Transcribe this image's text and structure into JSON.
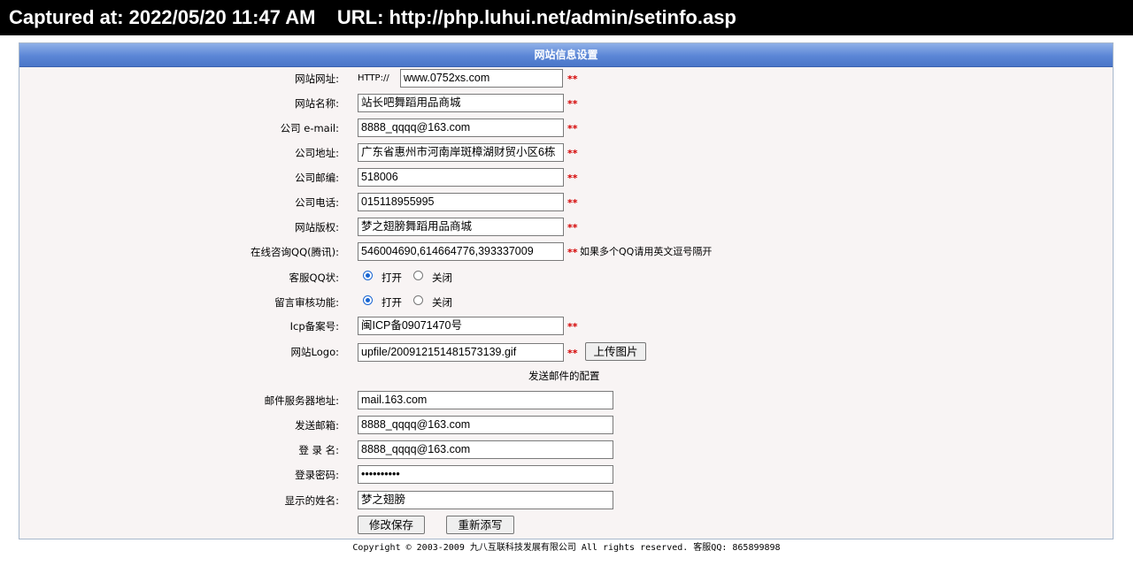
{
  "capture": {
    "text": "Captured at: 2022/05/20 11:47 AM    URL: http://php.luhui.net/admin/setinfo.asp"
  },
  "panel": {
    "title": "网站信息设置"
  },
  "required_mark": "**",
  "fields": {
    "site_url": {
      "label": "网站网址:",
      "prefix": "HTTP://",
      "value": "www.0752xs.com"
    },
    "site_name": {
      "label": "网站名称:",
      "value": "站长吧舞蹈用品商城"
    },
    "company_email": {
      "label": "公司 e-mail:",
      "value": "8888_qqqq@163.com"
    },
    "company_address": {
      "label": "公司地址:",
      "value": "广东省惠州市河南岸斑樟湖财贸小区6栋"
    },
    "company_zip": {
      "label": "公司邮编:",
      "value": "518006"
    },
    "company_phone": {
      "label": "公司电话:",
      "value": "015118955995"
    },
    "site_copyright": {
      "label": "网站版权:",
      "value": "梦之翅膀舞蹈用品商城"
    },
    "online_qq": {
      "label": "在线咨询QQ(腾讯):",
      "value": "546004690,614664776,393337009",
      "hint": "如果多个QQ请用英文逗号隔开"
    },
    "service_qq_status": {
      "label": "客服QQ状:",
      "options": [
        "打开",
        "关闭"
      ],
      "selected": "打开"
    },
    "message_review": {
      "label": "留言审核功能:",
      "options": [
        "打开",
        "关闭"
      ],
      "selected": "打开"
    },
    "icp": {
      "label": "Icp备案号:",
      "value": "闽ICP备09071470号"
    },
    "logo": {
      "label": "网站Logo:",
      "value": "upfile/200912151481573139.gif",
      "upload_button": "上传图片"
    }
  },
  "mail": {
    "section_title": "发送邮件的配置",
    "server": {
      "label": "邮件服务器地址:",
      "value": "mail.163.com"
    },
    "sender": {
      "label": "发送邮箱:",
      "value": "8888_qqqq@163.com"
    },
    "login_name": {
      "label": "登 录 名:",
      "value": "8888_qqqq@163.com"
    },
    "password": {
      "label": "登录密码:",
      "value": "••••••••••"
    },
    "display_name": {
      "label": "显示的姓名:",
      "value": "梦之翅膀"
    }
  },
  "actions": {
    "save": "修改保存",
    "reset": "重新添写"
  },
  "footer": {
    "text": "Copyright © 2003-2009 九八互联科技发展有限公司 All rights reserved. 客服QQ: 865899898"
  }
}
